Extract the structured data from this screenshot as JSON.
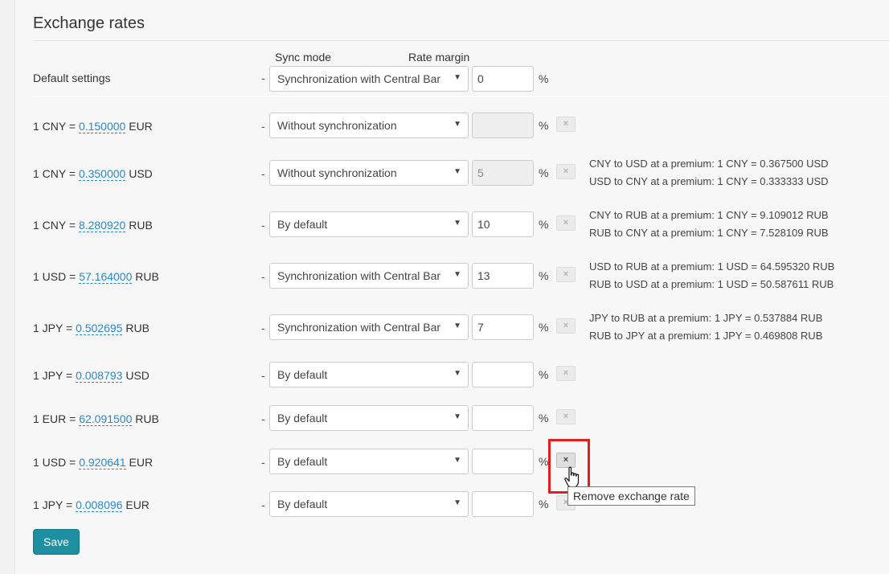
{
  "title": "Exchange rates",
  "headers": {
    "sync_mode": "Sync mode",
    "rate_margin": "Rate margin"
  },
  "default_settings": {
    "label": "Default settings",
    "dash": "-",
    "sync": "Synchronization with Central Bar",
    "margin": "0",
    "percent": "%"
  },
  "rows": [
    {
      "prefix": "1 CNY = ",
      "rate": "0.150000",
      "suffix": " EUR",
      "dash": "-",
      "sync": "Without synchronization",
      "margin": "",
      "margin_disabled": true,
      "percent": "%",
      "remove": "×",
      "premium": []
    },
    {
      "prefix": "1 CNY = ",
      "rate": "0.350000",
      "suffix": " USD",
      "dash": "-",
      "sync": "Without synchronization",
      "margin": "5",
      "margin_disabled": true,
      "percent": "%",
      "remove": "×",
      "premium": [
        "CNY to USD at a premium: 1 CNY = 0.367500 USD",
        "USD to CNY at a premium: 1 CNY = 0.333333 USD"
      ]
    },
    {
      "prefix": "1 CNY = ",
      "rate": "8.280920",
      "suffix": " RUB",
      "dash": "-",
      "sync": "By default",
      "margin": "10",
      "margin_disabled": false,
      "percent": "%",
      "remove": "×",
      "premium": [
        "CNY to RUB at a premium: 1 CNY = 9.109012 RUB",
        "RUB to CNY at a premium: 1 CNY = 7.528109 RUB"
      ]
    },
    {
      "prefix": "1 USD = ",
      "rate": "57.164000",
      "suffix": " RUB",
      "dash": "-",
      "sync": "Synchronization with Central Bar",
      "margin": "13",
      "margin_disabled": false,
      "percent": "%",
      "remove": "×",
      "premium": [
        "USD to RUB at a premium: 1 USD = 64.595320 RUB",
        "RUB to USD at a premium: 1 USD = 50.587611 RUB"
      ]
    },
    {
      "prefix": "1 JPY = ",
      "rate": "0.502695",
      "suffix": " RUB",
      "dash": "-",
      "sync": "Synchronization with Central Bar",
      "margin": "7",
      "margin_disabled": false,
      "percent": "%",
      "remove": "×",
      "premium": [
        "JPY to RUB at a premium: 1 JPY = 0.537884 RUB",
        "RUB to JPY at a premium: 1 JPY = 0.469808 RUB"
      ]
    },
    {
      "prefix": "1 JPY = ",
      "rate": "0.008793",
      "suffix": " USD",
      "dash": "-",
      "sync": "By default",
      "margin": "",
      "margin_disabled": false,
      "percent": "%",
      "remove": "×",
      "premium": []
    },
    {
      "prefix": "1 EUR = ",
      "rate": "62.091500",
      "suffix": " RUB",
      "dash": "-",
      "sync": "By default",
      "margin": "",
      "margin_disabled": false,
      "percent": "%",
      "remove": "×",
      "premium": []
    },
    {
      "prefix": "1 USD = ",
      "rate": "0.920641",
      "suffix": " EUR",
      "dash": "-",
      "sync": "By default",
      "margin": "",
      "margin_disabled": false,
      "percent": "%",
      "remove": "×",
      "premium": []
    },
    {
      "prefix": "1 JPY = ",
      "rate": "0.008096",
      "suffix": " EUR",
      "dash": "-",
      "sync": "By default",
      "margin": "",
      "margin_disabled": false,
      "percent": "%",
      "remove": "×",
      "premium": []
    }
  ],
  "tooltip": "Remove exchange rate",
  "save_label": "Save",
  "colors": {
    "accent": "#1e8fa0",
    "link": "#2a88c8",
    "highlight": "#e02020"
  },
  "icons": {
    "select_arrow": "▼",
    "cursor": "hand-pointer-icon"
  }
}
